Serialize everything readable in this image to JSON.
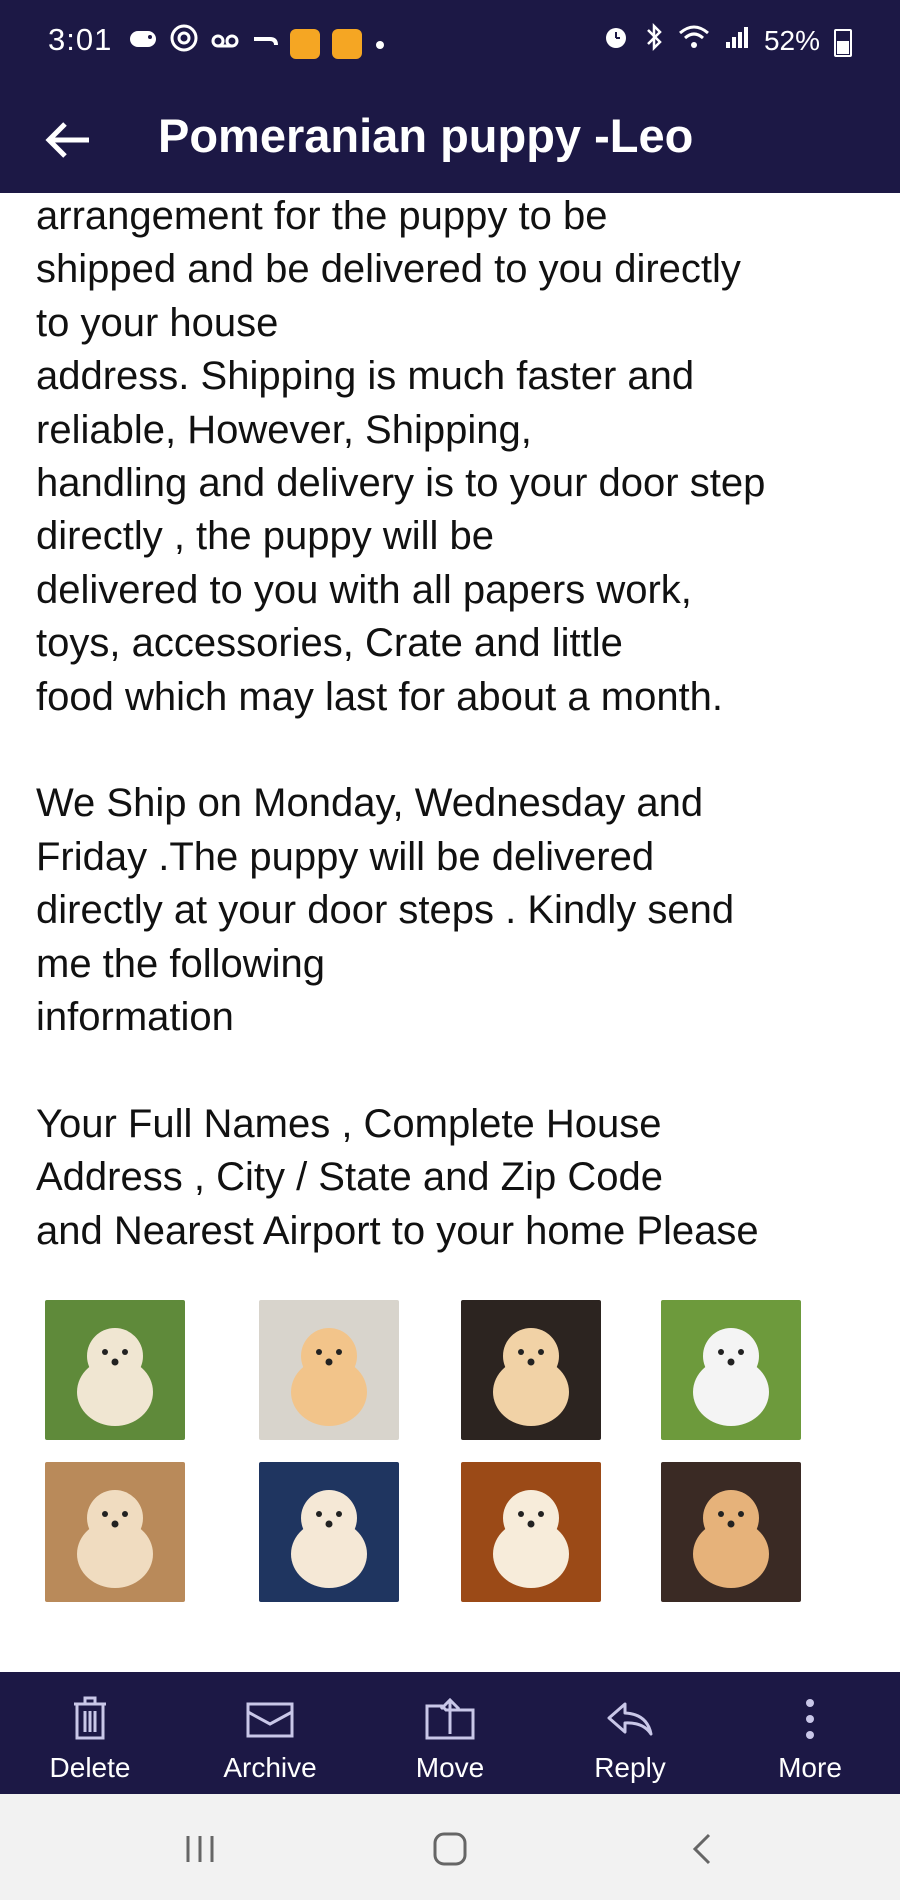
{
  "status_bar": {
    "time": "3:01",
    "battery": "52%",
    "icons": [
      "game-controller-icon",
      "podcast-icon",
      "voicemail-icon",
      "arrow-icon",
      "emoji-badge-icon",
      "emoji-badge-icon",
      "dot-icon",
      "alarm-icon",
      "bluetooth-icon",
      "wifi-icon",
      "signal-icon",
      "battery-icon"
    ]
  },
  "header": {
    "title": "Pomeranian puppy -Leo",
    "back_icon": "arrow-left-icon"
  },
  "message": {
    "paragraph1": [
      "arrangement for the puppy to be",
      "shipped and be delivered to you directly",
      "to your house",
      "address. Shipping  is much faster and",
      "reliable, However, Shipping,",
      "handling and delivery is to your door step",
      "directly , the puppy will be",
      "delivered to you with all papers work,",
      "toys, accessories, Crate and little",
      "food which may last for about a month."
    ],
    "paragraph2": [
      "We Ship on Monday, Wednesday and",
      "Friday .The puppy will be delivered",
      "directly at your door steps . Kindly send",
      "me the following",
      "information"
    ],
    "paragraph3": [
      "Your Full Names , Complete House",
      "Address , City / State  and Zip Code",
      "and Nearest Airport to your home Please"
    ]
  },
  "images": [
    {
      "name": "puppy-photo-1",
      "bg": "#5f8a3a",
      "fur": "#f0e6d2"
    },
    {
      "name": "puppy-photo-2",
      "bg": "#d8d4cc",
      "fur": "#f2c48a"
    },
    {
      "name": "puppy-photo-3",
      "bg": "#2c2420",
      "fur": "#f1d2a6"
    },
    {
      "name": "puppy-photo-4",
      "bg": "#6d9a3c",
      "fur": "#f4f4f4"
    },
    {
      "name": "puppy-photo-5",
      "bg": "#b98a5a",
      "fur": "#f0dcc0"
    },
    {
      "name": "puppy-photo-6",
      "bg": "#1f3560",
      "fur": "#f5e8d6"
    },
    {
      "name": "puppy-photo-7",
      "bg": "#9b4a17",
      "fur": "#f7ecda"
    },
    {
      "name": "puppy-photo-8",
      "bg": "#3a2a24",
      "fur": "#e6b27a"
    }
  ],
  "toolbar": {
    "delete": "Delete",
    "archive": "Archive",
    "move": "Move",
    "reply": "Reply",
    "more": "More"
  },
  "colors": {
    "bar_background": "#1c1845",
    "text": "#111111",
    "nav_background": "#f2f2f2"
  }
}
